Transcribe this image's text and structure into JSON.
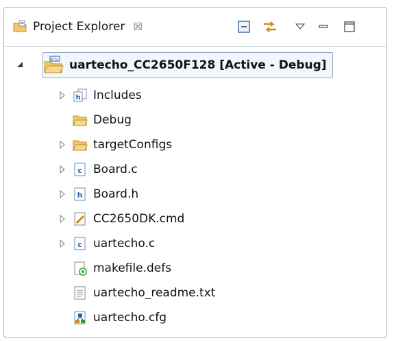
{
  "view": {
    "tab_title": "Project Explorer",
    "close_glyph": "☒"
  },
  "toolbar": {
    "buttons": [
      {
        "name": "collapse-all-button",
        "icon": "collapse-all-icon"
      },
      {
        "name": "link-with-editor-button",
        "icon": "link-with-editor-icon"
      },
      {
        "name": "view-menu-button",
        "icon": "view-menu-icon"
      },
      {
        "name": "minimize-button",
        "icon": "minimize-icon"
      },
      {
        "name": "maximize-button",
        "icon": "maximize-icon"
      }
    ]
  },
  "tree": {
    "project": {
      "label": "uartecho_CC2650F128  [Active - Debug]",
      "badge": "RTSC",
      "expanded": true,
      "icon": "rtsc-project-folder-icon"
    },
    "items": [
      {
        "label": "Includes",
        "icon": "includes-icon",
        "expandable": true
      },
      {
        "label": "Debug",
        "icon": "folder-icon",
        "expandable": false
      },
      {
        "label": "targetConfigs",
        "icon": "folder-icon",
        "expandable": true
      },
      {
        "label": "Board.c",
        "icon": "c-source-file-icon",
        "expandable": true
      },
      {
        "label": "Board.h",
        "icon": "c-header-file-icon",
        "expandable": true
      },
      {
        "label": "CC2650DK.cmd",
        "icon": "linker-command-file-icon",
        "expandable": true
      },
      {
        "label": "uartecho.c",
        "icon": "c-source-file-icon",
        "expandable": true
      },
      {
        "label": "makefile.defs",
        "icon": "makefile-icon",
        "expandable": false
      },
      {
        "label": "uartecho_readme.txt",
        "icon": "text-file-icon",
        "expandable": false
      },
      {
        "label": "uartecho.cfg",
        "icon": "rtsc-config-file-icon",
        "expandable": false
      }
    ]
  },
  "colors": {
    "folder": "#f2c868",
    "accent_blue": "#2f5fa6",
    "border": "#a8b7cc"
  }
}
